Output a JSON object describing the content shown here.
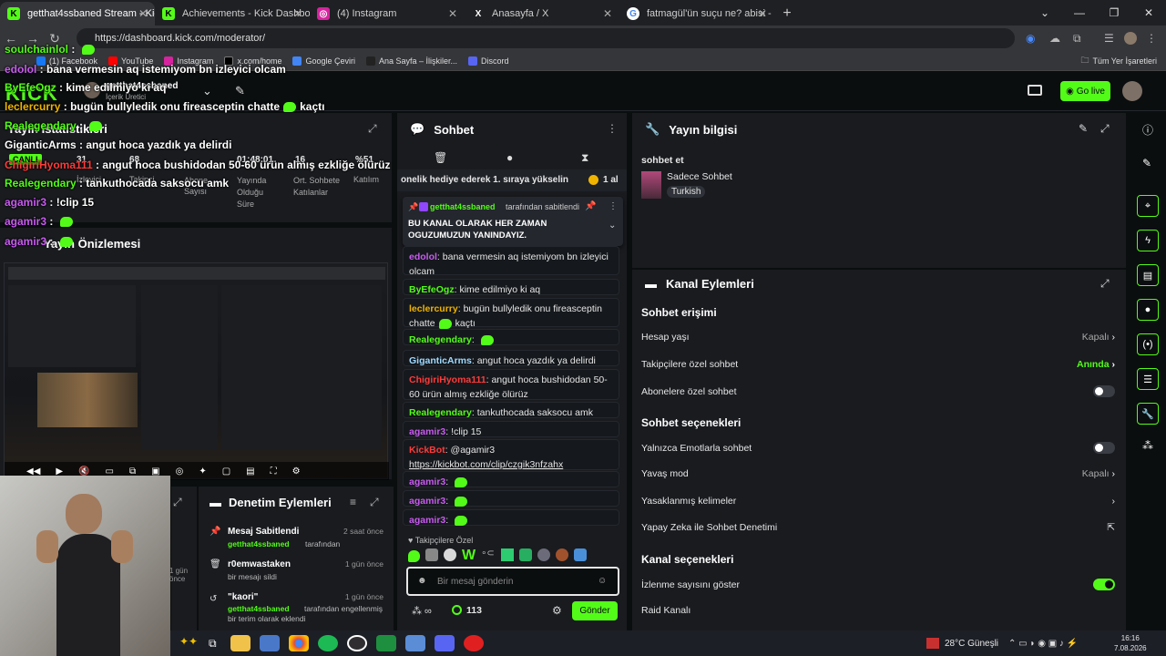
{
  "browser": {
    "tabs": [
      {
        "label": "getthat4ssbaned Stream - Kick",
        "color": "#53fc18",
        "glyph": "K"
      },
      {
        "label": "Achievements - Kick Dashboard",
        "color": "#53fc18",
        "glyph": "K"
      },
      {
        "label": "(4) Instagram",
        "color": "#d6249f",
        "glyph": "◎"
      },
      {
        "label": "Anasayfa / X",
        "color": "#ffffff",
        "glyph": "X"
      },
      {
        "label": "fatmagül'ün suçu ne? abisi - Go...",
        "color": "#4285f4",
        "glyph": "G"
      }
    ],
    "url": "https://dashboard.kick.com/moderator/",
    "bookmarks": [
      "(1) Facebook",
      "YouTube",
      "Instagram",
      "x.com/home",
      "Google Çeviri",
      "Ana Sayfa – İlişkiler...",
      "Discord"
    ],
    "bookmarks_right": "Tüm Yer İşaretleri"
  },
  "header": {
    "brand": "KICK",
    "channel": "getthat4ssbaned",
    "role": "İçerik Üretici",
    "go_live": "Go live"
  },
  "stats": {
    "title": "Yayın İstatistikleri",
    "values": [
      "31",
      "68",
      "01:48:01",
      "16",
      "%51"
    ],
    "labels": [
      "İzleyici",
      "Takipçi",
      "Abone Sayısı",
      "Yayında Olduğu Süre",
      "Ort. Sohbete Katılanlar",
      "Katılım"
    ],
    "live_badge": "CANLI"
  },
  "preview": {
    "title": "Yayın Önizlemesi"
  },
  "chat": {
    "title": "Sohbet",
    "gift_banner": "onelik hediye ederek 1. sıraya yükselin",
    "gift_count": "1 al",
    "pinned_by": "getthat4ssbaned",
    "pinned_suffix": "tarafından sabitlendi",
    "pinned_text": "BU KANAL OLARAK HER ZAMAN OGUZUMUZUN YANINDAYIZ.",
    "messages": [
      {
        "user": "edolol",
        "color": "#c85bf0",
        "text": "bana vermesin aq istemiyom bn izleyici olcam"
      },
      {
        "user": "ByEfeOgz",
        "color": "#53fc18",
        "text": "kime edilmiyo ki aq"
      },
      {
        "user": "leclercurry",
        "color": "#f0b400",
        "text": "bugün bullyledik onu fireasceptin chatte",
        "tail": "kaçtı"
      },
      {
        "user": "Realegendary",
        "color": "#53fc18",
        "text": ""
      },
      {
        "user": "GiganticArms",
        "color": "#9fd9ff",
        "text": "angut hoca yazdık ya delirdi"
      },
      {
        "user": "ChigiriHyoma111",
        "color": "#ff3b3b",
        "text": "angut hoca bushidodan 50-60 ürün almış ezkliğe ölürüz"
      },
      {
        "user": "Realegendary",
        "color": "#53fc18",
        "text": "tankuthocada saksocu amk"
      },
      {
        "user": "agamir3",
        "color": "#c85bf0",
        "text": "!clip 15"
      },
      {
        "user": "KickBot",
        "color": "#ff3b3b",
        "text": "@agamir3",
        "link": "https://kickbot.com/clip/czgik3nfzahx"
      },
      {
        "user": "agamir3",
        "color": "#c85bf0",
        "text": ""
      },
      {
        "user": "agamir3",
        "color": "#c85bf0",
        "text": ""
      },
      {
        "user": "agamir3",
        "color": "#c85bf0",
        "text": ""
      }
    ],
    "followers_only": "Takipçilere Özel",
    "input_placeholder": "Bir mesaj gönderin",
    "points": "113",
    "send": "Gönder"
  },
  "overlay": [
    {
      "user": "soulchainlol",
      "color": "#53fc18",
      "text": ""
    },
    {
      "user": "edolol",
      "color": "#c85bf0",
      "text": "bana vermesin aq istemiyom bn izleyici olcam"
    },
    {
      "user": "ByEfeOgz",
      "color": "#53fc18",
      "text": "kime edilmiyo ki aq"
    },
    {
      "user": "leclercurry",
      "color": "#f0b400",
      "text": "bugün bullyledik onu fireasceptin chatte",
      "tail": "kaçtı"
    },
    {
      "user": "Realegendary",
      "color": "#53fc18",
      "text": ""
    },
    {
      "user": "GiganticArms",
      "color": "#ffffff",
      "text": "angut hoca yazdık ya delirdi"
    },
    {
      "user": "ChigiriHyoma111",
      "color": "#ff3b3b",
      "text": "angut hoca bushidodan 50-60 ürün almış ezkliğe ölürüz"
    },
    {
      "user": "Realegendary",
      "color": "#53fc18",
      "text": "tankuthocada saksocu amk"
    },
    {
      "user": "agamir3",
      "color": "#c85bf0",
      "text": "!clip 15"
    },
    {
      "user": "agamir3",
      "color": "#c85bf0",
      "text": ""
    },
    {
      "user": "agamir3",
      "color": "#c85bf0",
      "text": ""
    }
  ],
  "modlog": {
    "title": "Denetim Eylemleri",
    "items": [
      {
        "title": "Mesaj Sabitlendi",
        "who": "getthat4ssbaned",
        "what": "tarafından",
        "time": "2 saat önce"
      },
      {
        "title": "r0emwastaken",
        "who": "",
        "what": "bir mesajı sildi",
        "time": "1 gün önce"
      },
      {
        "title": "\"kaori\"",
        "who": "getthat4ssbaned",
        "what": "tarafından engellenmiş bir terim olarak eklendi",
        "time": "1 gün önce"
      }
    ],
    "side_time": "1 gün önce"
  },
  "stream_info": {
    "title": "Yayın bilgisi",
    "stream_title": "sohbet et",
    "category": "Sadece Sohbet",
    "language": "Turkish"
  },
  "channel_actions": {
    "title": "Kanal Eylemleri",
    "chat_access": "Sohbet erişimi",
    "account_age": {
      "label": "Hesap yaşı",
      "value": "Kapalı"
    },
    "followers_only": {
      "label": "Takipçilere özel sohbet",
      "value": "Anında"
    },
    "subs_only": {
      "label": "Abonelere özel sohbet",
      "on": false
    },
    "chat_options": "Sohbet seçenekleri",
    "emotes_only": {
      "label": "Yalnızca Emotlarla sohbet",
      "on": false
    },
    "slow_mode": {
      "label": "Yavaş mod",
      "value": "Kapalı"
    },
    "banned_words": {
      "label": "Yasaklanmış kelimeler"
    },
    "ai_moderation": {
      "label": "Yapay Zeka ile Sohbet Denetimi"
    },
    "channel_options": "Kanal seçenekleri",
    "show_viewers": {
      "label": "İzlenme sayısını göster",
      "on": true
    },
    "raid": {
      "label": "Raid Kanalı"
    }
  },
  "taskbar": {
    "weather": "28°C Güneşli",
    "time": "16:16",
    "date": "7.08.2026"
  }
}
